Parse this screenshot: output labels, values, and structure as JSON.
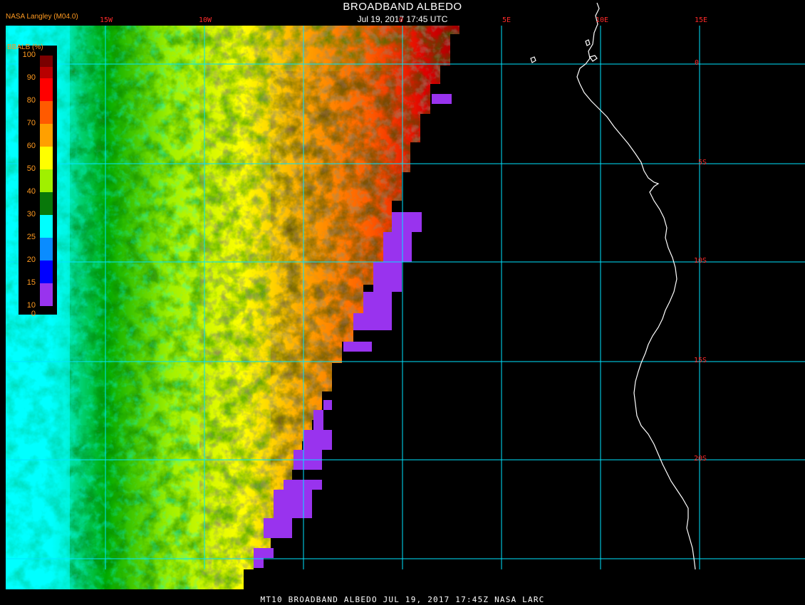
{
  "header": {
    "title": "BROADBAND ALBEDO",
    "subtitle": "Jul 19, 2017 17:45 UTC",
    "credit": "NASA Langley (M04.0)"
  },
  "footer": {
    "text": "MT10  BROADBAND ALBEDO   JUL 19, 2017 17:45Z   NASA LARC"
  },
  "legend": {
    "title": "BBALB (%)",
    "ticks": [
      "100",
      "90",
      "80",
      "70",
      "60",
      "50",
      "40",
      "30",
      "25",
      "20",
      "15",
      "10",
      "0"
    ],
    "colors": [
      "#7a0000",
      "#b80000",
      "#ff0000",
      "#ff5a00",
      "#ffa000",
      "#ffff00",
      "#a0f000",
      "#00aa00",
      "#08780a",
      "#00ffff",
      "#0a8cff",
      "#0000ff",
      "#9933ee"
    ]
  },
  "grid": {
    "longitude_labels": [
      "15W",
      "10W",
      "0",
      "5E",
      "10E",
      "15E"
    ],
    "latitude_labels": [
      "0",
      "5S",
      "10S",
      "15S",
      "20S"
    ],
    "line_color": "#00e5ff",
    "label_color": "#ff2a2a",
    "coastline_color": "#ffffff"
  },
  "colors": {
    "background": "#000000",
    "no_cloud_fill": "#9933ee"
  }
}
